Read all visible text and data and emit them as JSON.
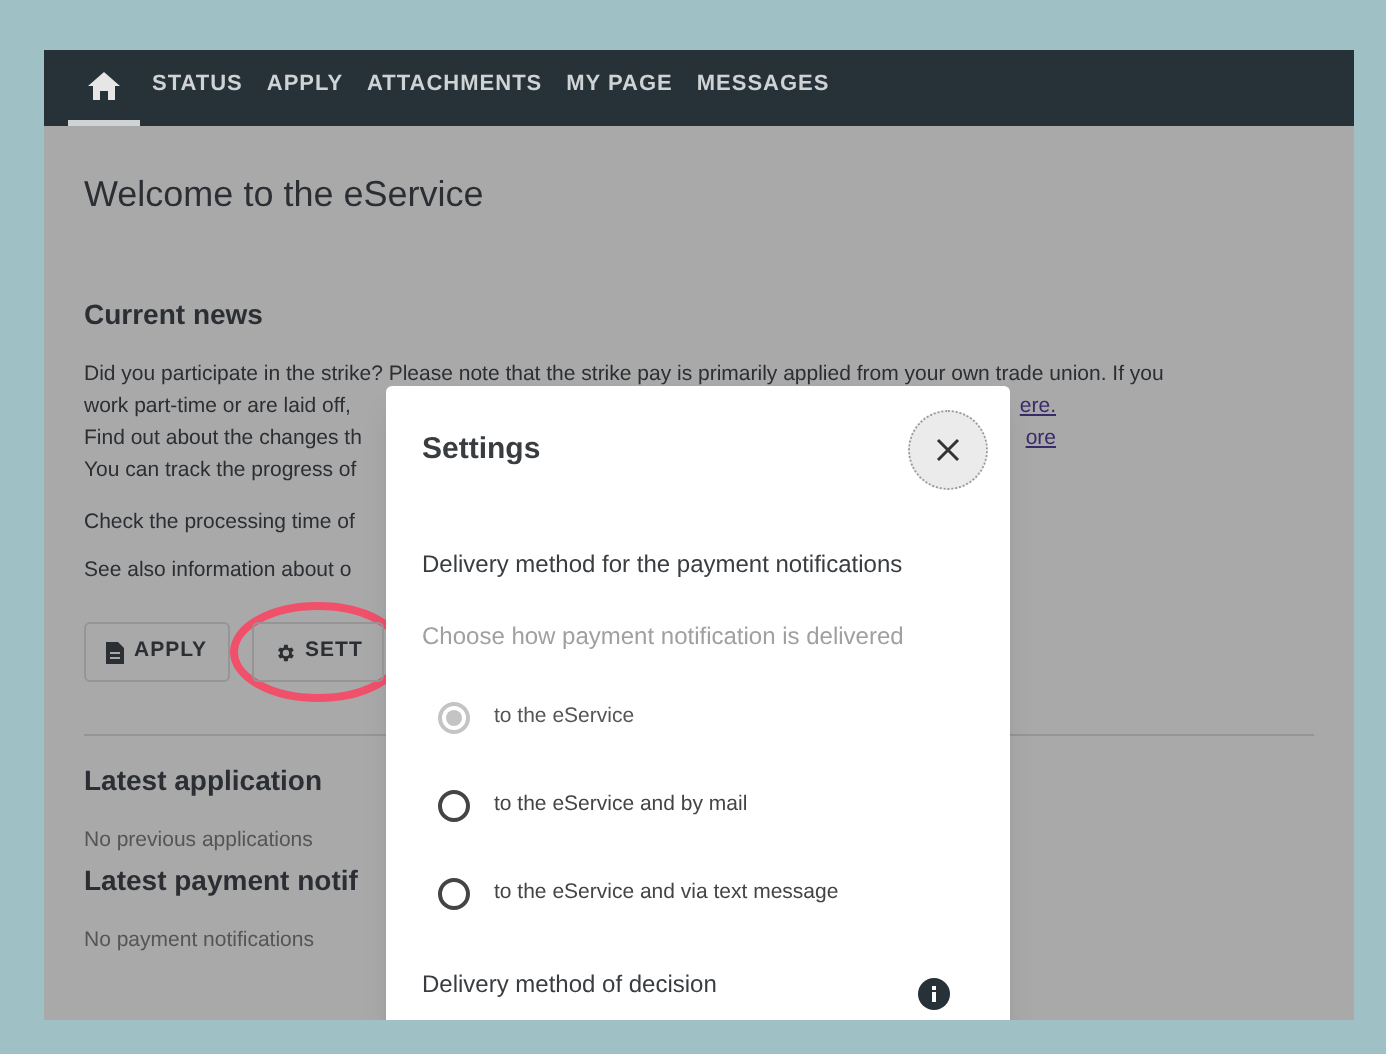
{
  "nav": {
    "tabs": [
      {
        "kind": "home",
        "selected": true
      },
      {
        "kind": "text",
        "label": "STATUS",
        "selected": false
      },
      {
        "kind": "text",
        "label": "APPLY",
        "selected": false
      },
      {
        "kind": "text",
        "label": "ATTACHMENTS",
        "selected": false
      },
      {
        "kind": "text",
        "label": "MY PAGE",
        "selected": false
      },
      {
        "kind": "text",
        "label": "MESSAGES",
        "selected": false
      }
    ]
  },
  "page": {
    "title": "Welcome to the eService",
    "news_heading": "Current news",
    "news_lines": [
      {
        "left": "Did you participate in the strike? Please note that the strike pay is primarily applied from your own trade union. If you"
      },
      {
        "left": "work part-time or are laid off,",
        "link": "ere."
      },
      {
        "left": "Find out about the changes th",
        "link": "ore"
      },
      {
        "left": "You can track the progress of"
      }
    ],
    "info_lines": [
      "Check the processing time of",
      "See also information about o"
    ],
    "buttons": [
      {
        "kind": "apply",
        "label": "APPLY"
      },
      {
        "kind": "settings",
        "label": "SETT",
        "highlighted": true
      }
    ],
    "sections": [
      {
        "heading": "Latest application",
        "text": "No previous applications"
      },
      {
        "heading": "Latest payment notif",
        "text": "No payment notifications"
      }
    ]
  },
  "dialog": {
    "title": "Settings",
    "payment_heading": "Delivery method for the payment notifications",
    "payment_hint": "Choose how payment notification is delivered",
    "options": [
      {
        "label": "to the eService",
        "selected": true,
        "disabled": true
      },
      {
        "label": "to the eService and by mail",
        "selected": false,
        "disabled": false
      },
      {
        "label": "to the eService and via text message",
        "selected": false,
        "disabled": false
      }
    ],
    "decision_heading": "Delivery method of decision"
  }
}
